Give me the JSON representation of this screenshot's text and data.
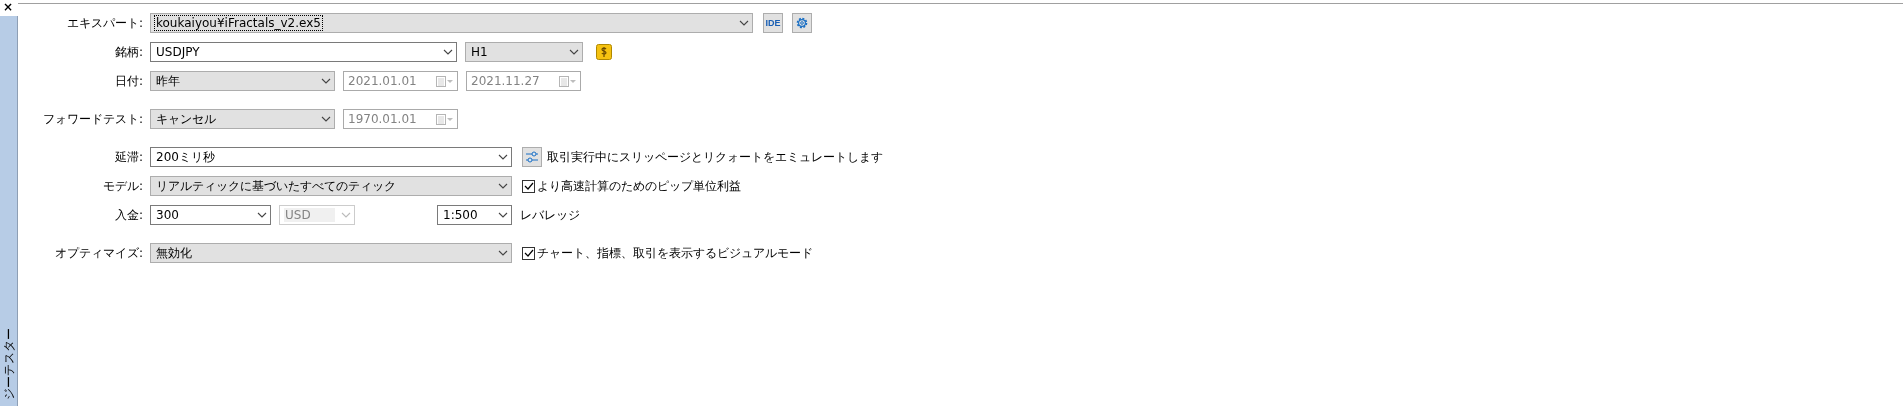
{
  "panel": {
    "close": "×",
    "title": "ジーテスター"
  },
  "rows": [
    {
      "label": "エキスパート:",
      "controls": [
        {
          "kind": "combo",
          "value": "koukaiyou¥iFractals_v2.ex5",
          "editable": false,
          "disabled": false,
          "focused": true
        },
        {
          "kind": "text-button",
          "text": "IDE"
        },
        {
          "kind": "icon-button"
        }
      ]
    },
    {
      "label": "銘柄:",
      "controls": [
        {
          "kind": "combo",
          "value": "USDJPY",
          "editable": true,
          "disabled": false
        },
        {
          "kind": "combo",
          "value": "H1",
          "editable": false,
          "disabled": false
        },
        {
          "kind": "icon-button"
        }
      ]
    },
    {
      "label": "日付:",
      "controls": [
        {
          "kind": "combo",
          "value": "昨年",
          "editable": false,
          "disabled": false
        },
        {
          "kind": "date",
          "value": "2021.01.01",
          "disabled": true
        },
        {
          "kind": "date",
          "value": "2021.11.27",
          "disabled": true
        }
      ]
    },
    {
      "label": "フォワードテスト:",
      "controls": [
        {
          "kind": "combo",
          "value": "キャンセル",
          "editable": false,
          "disabled": false
        },
        {
          "kind": "date",
          "value": "1970.01.01",
          "disabled": true
        }
      ]
    },
    {
      "label": "延滞:",
      "controls": [
        {
          "kind": "combo",
          "value": "200ミリ秒",
          "editable": true,
          "disabled": false
        },
        {
          "kind": "icon-button"
        },
        {
          "kind": "text",
          "text": "取引実行中にスリッページとリクォートをエミュレートします"
        }
      ]
    },
    {
      "label": "モデル:",
      "controls": [
        {
          "kind": "combo",
          "value": "リアルティックに基づいたすべてのティック",
          "editable": false,
          "disabled": false
        },
        {
          "kind": "checkbox",
          "text": "より高速計算のためのピップ単位利益",
          "checked": true
        }
      ]
    },
    {
      "label": "入金:",
      "controls": [
        {
          "kind": "combo",
          "value": "300",
          "editable": true,
          "disabled": false
        },
        {
          "kind": "combo",
          "value": "USD",
          "editable": true,
          "disabled": true
        },
        {
          "kind": "combo",
          "value": "1:500",
          "editable": true,
          "disabled": false
        },
        {
          "kind": "text",
          "text": "レバレッジ"
        }
      ]
    },
    {
      "label": "オプティマイズ:",
      "controls": [
        {
          "kind": "combo",
          "value": "無効化",
          "editable": false,
          "disabled": false
        },
        {
          "kind": "checkbox",
          "text": "チャート、指標、取引を表示するビジュアルモード",
          "checked": true
        }
      ]
    }
  ]
}
